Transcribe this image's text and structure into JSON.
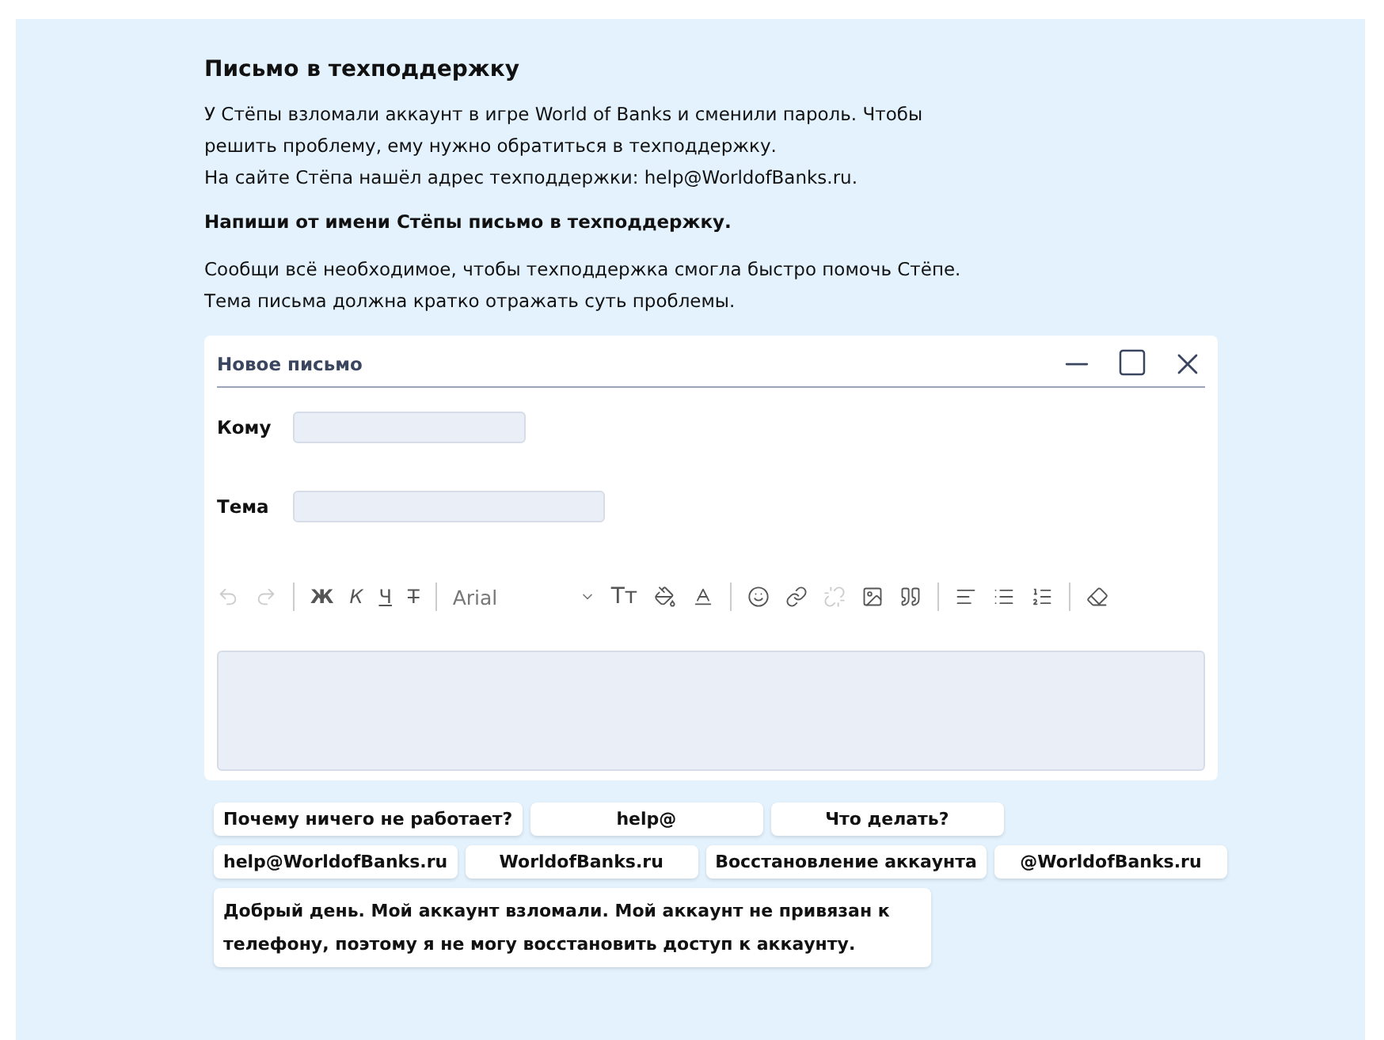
{
  "title": "Письмо в техподдержку",
  "intro": [
    "У Стёпы взломали аккаунт в игре World of Banks и сменили пароль. Чтобы",
    "решить проблему, ему нужно обратиться в техподдержку.",
    "На сайте Стёпа нашёл адрес техподдержки: help@WorldofBanks.ru."
  ],
  "task": "Напиши от имени Стёпы письмо в техподдержку.",
  "hint": [
    "Сообщи всё необходимое, чтобы техподдержка смогла быстро помочь Стёпе.",
    "Тема письма должна кратко отражать суть проблемы."
  ],
  "mail_window": {
    "title": "Новое письмо",
    "fields": [
      {
        "label": "Кому"
      },
      {
        "label": "Тема"
      }
    ],
    "toolbar": {
      "format_buttons": [
        "Ж",
        "К",
        "Ч",
        "Т"
      ],
      "font": "Arial",
      "size_button": "Тт"
    }
  },
  "chip_rows": [
    [
      "Почему ничего не работает?",
      "help@",
      "Что делать?"
    ],
    [
      "help@WorldofBanks.ru",
      "WorldofBanks.ru",
      "Восстановление аккаунта",
      "@WorldofBanks.ru"
    ],
    [
      "Добрый день. Мой аккаунт взломали. Мой аккаунт не привязан к телефону, поэтому я не могу восстановить доступ к аккаунту."
    ]
  ]
}
